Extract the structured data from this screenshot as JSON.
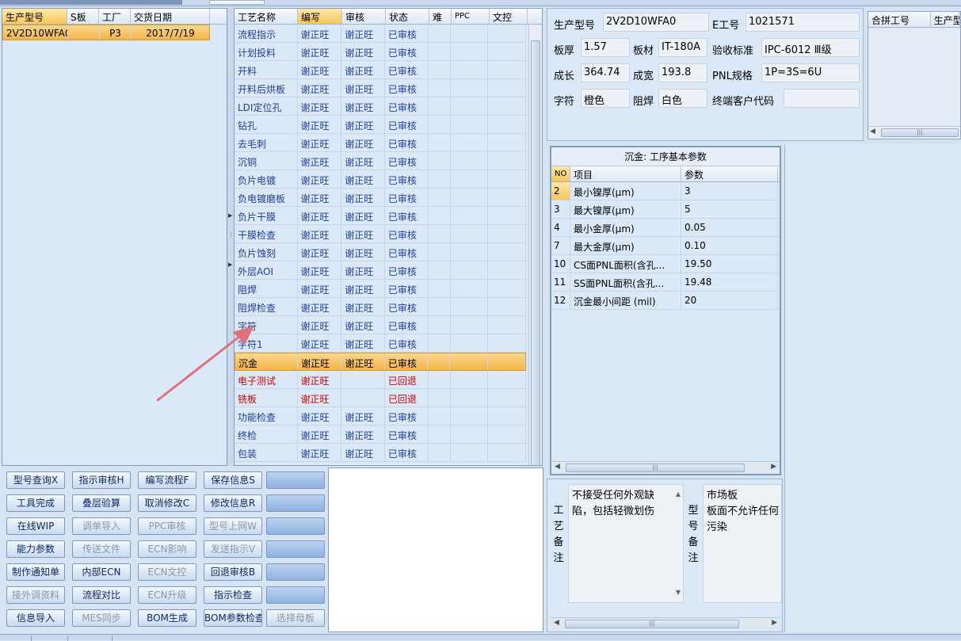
{
  "model_grid": {
    "headers": [
      "生产型号",
      "S板",
      "工厂",
      "交货日期"
    ],
    "rows": [
      [
        "2V2D10WFA0",
        "",
        "P3",
        "2017/7/19"
      ]
    ]
  },
  "process_grid": {
    "headers": [
      "工艺名称",
      "编写",
      "审核",
      "状态",
      "难",
      "PPC",
      "文控"
    ],
    "rows": [
      {
        "name": "流程指示",
        "writer": "谢正旺",
        "reviewer": "谢正旺",
        "status": "已审核",
        "color": "blue"
      },
      {
        "name": "计划投料",
        "writer": "谢正旺",
        "reviewer": "谢正旺",
        "status": "已审核",
        "color": "blue"
      },
      {
        "name": "开料",
        "writer": "谢正旺",
        "reviewer": "谢正旺",
        "status": "已审核",
        "color": "blue"
      },
      {
        "name": "开料后烘板",
        "writer": "谢正旺",
        "reviewer": "谢正旺",
        "status": "已审核",
        "color": "blue"
      },
      {
        "name": "LDI定位孔",
        "writer": "谢正旺",
        "reviewer": "谢正旺",
        "status": "已审核",
        "color": "blue"
      },
      {
        "name": "钻孔",
        "writer": "谢正旺",
        "reviewer": "谢正旺",
        "status": "已审核",
        "color": "blue"
      },
      {
        "name": "去毛刺",
        "writer": "谢正旺",
        "reviewer": "谢正旺",
        "status": "已审核",
        "color": "blue"
      },
      {
        "name": "沉铜",
        "writer": "谢正旺",
        "reviewer": "谢正旺",
        "status": "已审核",
        "color": "blue"
      },
      {
        "name": "负片电镀",
        "writer": "谢正旺",
        "reviewer": "谢正旺",
        "status": "已审核",
        "color": "blue"
      },
      {
        "name": "负电镀磨板",
        "writer": "谢正旺",
        "reviewer": "谢正旺",
        "status": "已审核",
        "color": "blue"
      },
      {
        "name": "负片干膜",
        "writer": "谢正旺",
        "reviewer": "谢正旺",
        "status": "已审核",
        "color": "blue"
      },
      {
        "name": "干膜检查",
        "writer": "谢正旺",
        "reviewer": "谢正旺",
        "status": "已审核",
        "color": "blue"
      },
      {
        "name": "负片蚀刻",
        "writer": "谢正旺",
        "reviewer": "谢正旺",
        "status": "已审核",
        "color": "blue"
      },
      {
        "name": "外层AOI",
        "writer": "谢正旺",
        "reviewer": "谢正旺",
        "status": "已审核",
        "color": "blue"
      },
      {
        "name": "阻焊",
        "writer": "谢正旺",
        "reviewer": "谢正旺",
        "status": "已审核",
        "color": "blue"
      },
      {
        "name": "阻焊检查",
        "writer": "谢正旺",
        "reviewer": "谢正旺",
        "status": "已审核",
        "color": "blue"
      },
      {
        "name": "字符",
        "writer": "谢正旺",
        "reviewer": "谢正旺",
        "status": "已审核",
        "color": "blue"
      },
      {
        "name": "字符1",
        "writer": "谢正旺",
        "reviewer": "谢正旺",
        "status": "已审核",
        "color": "blue"
      },
      {
        "name": "沉金",
        "writer": "谢正旺",
        "reviewer": "谢正旺",
        "status": "已审核",
        "color": "black",
        "selected": true
      },
      {
        "name": "电子测试",
        "writer": "谢正旺",
        "reviewer": "",
        "status": "已回退",
        "color": "red"
      },
      {
        "name": "铣板",
        "writer": "谢正旺",
        "reviewer": "",
        "status": "已回退",
        "color": "red"
      },
      {
        "name": "功能检查",
        "writer": "谢正旺",
        "reviewer": "谢正旺",
        "status": "已审核",
        "color": "blue"
      },
      {
        "name": "终检",
        "writer": "谢正旺",
        "reviewer": "谢正旺",
        "status": "已审核",
        "color": "blue"
      },
      {
        "name": "包装",
        "writer": "谢正旺",
        "reviewer": "谢正旺",
        "status": "已审核",
        "color": "blue"
      }
    ]
  },
  "buttons": [
    [
      {
        "label": "型号查询X",
        "state": "normal"
      },
      {
        "label": "指示审核H",
        "state": "normal"
      },
      {
        "label": "编写流程F",
        "state": "normal"
      },
      {
        "label": "保存信息S",
        "state": "normal"
      },
      {
        "label": "",
        "state": "blank"
      }
    ],
    [
      {
        "label": "工具完成",
        "state": "normal"
      },
      {
        "label": "叠层验算",
        "state": "normal"
      },
      {
        "label": "取消修改C",
        "state": "normal"
      },
      {
        "label": "修改信息R",
        "state": "normal"
      },
      {
        "label": "",
        "state": "blank"
      }
    ],
    [
      {
        "label": "在线WIP",
        "state": "normal"
      },
      {
        "label": "调单导入",
        "state": "disabled"
      },
      {
        "label": "PPC审核",
        "state": "disabled"
      },
      {
        "label": "型号上网W",
        "state": "disabled"
      },
      {
        "label": "",
        "state": "blank"
      }
    ],
    [
      {
        "label": "能力参数",
        "state": "normal"
      },
      {
        "label": "传送文件",
        "state": "disabled"
      },
      {
        "label": "ECN影响",
        "state": "disabled"
      },
      {
        "label": "发送指示V",
        "state": "disabled"
      },
      {
        "label": "",
        "state": "blank"
      }
    ],
    [
      {
        "label": "制作通知单",
        "state": "normal"
      },
      {
        "label": "内部ECN",
        "state": "normal"
      },
      {
        "label": "ECN文控",
        "state": "disabled"
      },
      {
        "label": "回退审核B",
        "state": "normal"
      },
      {
        "label": "",
        "state": "blank"
      }
    ],
    [
      {
        "label": "接外调资料",
        "state": "disabled"
      },
      {
        "label": "流程对比",
        "state": "normal"
      },
      {
        "label": "ECN升级",
        "state": "disabled"
      },
      {
        "label": "指示检查",
        "state": "normal"
      },
      {
        "label": "",
        "state": "blank"
      }
    ],
    [
      {
        "label": "信息导入",
        "state": "normal"
      },
      {
        "label": "MES同步",
        "state": "disabled"
      },
      {
        "label": "BOM生成",
        "state": "normal"
      },
      {
        "label": "BOM参数检查",
        "state": "normal"
      },
      {
        "label": "选择母板",
        "state": "disabled"
      }
    ]
  ],
  "info": {
    "model_label": "生产型号",
    "model_value": "2V2D10WFA0",
    "e_label": "E工号",
    "e_value": "1021571",
    "thickness_label": "板厚",
    "thickness_value": "1.57",
    "material_label": "板材",
    "material_value": "IT-180A",
    "standard_label": "验收标准",
    "standard_value": "IPC-6012 Ⅲ级",
    "length_label": "成长",
    "length_value": "364.74",
    "width_label": "成宽",
    "width_value": "193.8",
    "pnl_label": "PNL规格",
    "pnl_value": "1P=3S=6U",
    "char_label": "字符",
    "char_value": "橙色",
    "mask_label": "阻焊",
    "mask_value": "白色",
    "customer_label": "终端客户代码",
    "customer_value": ""
  },
  "combo_grid": {
    "headers": [
      "合拼工号",
      "生产型"
    ]
  },
  "params": {
    "title": "沉金: 工序基本参数",
    "headers": [
      "NO",
      "项目",
      "参数"
    ],
    "rows": [
      {
        "no": "2",
        "item": "最小镍厚(μm)",
        "value": "3",
        "highlight": true
      },
      {
        "no": "3",
        "item": "最大镍厚(μm)",
        "value": "5"
      },
      {
        "no": "4",
        "item": "最小金厚(μm)",
        "value": "0.05"
      },
      {
        "no": "7",
        "item": "最大金厚(μm)",
        "value": "0.10"
      },
      {
        "no": "10",
        "item": "CS面PNL面积(含孔...",
        "value": "19.50"
      },
      {
        "no": "11",
        "item": "SS面PNL面积(含孔...",
        "value": "19.48"
      },
      {
        "no": "12",
        "item": "沉金最小间距 (mil)",
        "value": "20"
      }
    ]
  },
  "remarks": {
    "process_label": [
      "工",
      "艺",
      "备",
      "注"
    ],
    "process_text": "不接受任何外观缺陷，包括轻微划伤",
    "model_label": [
      "型",
      "号",
      "备",
      "注"
    ],
    "model_text": "市场板\n板面不允许任何污染"
  },
  "icons": {
    "splitter_arrow": "triangle-right-icon",
    "scroll_grip": "grip-icon",
    "scroll_up": "triangle-up-icon",
    "scroll_down": "triangle-down-icon",
    "scroll_left": "triangle-left-icon",
    "scroll_right": "triangle-right-icon",
    "annotation_arrow": "annotation-arrow-icon"
  },
  "colors": {
    "selected_row": "#f2b44a",
    "blue_text": "#1e3f9a",
    "red_text": "#d10000",
    "annotation_arrow": "#e0707a"
  }
}
